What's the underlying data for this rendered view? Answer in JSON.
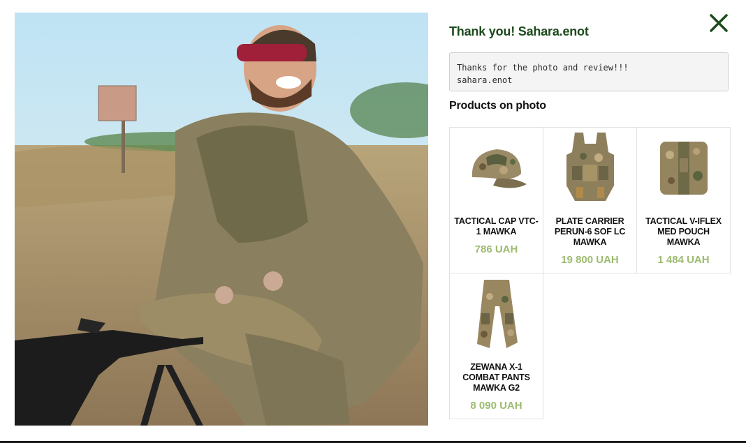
{
  "modal": {
    "title": "Thank you! Sahara.enot",
    "comment": "Thanks for the photo and review!!!\nsahara.enot",
    "products_heading": "Products on photo"
  },
  "colors": {
    "title": "#1d4a1d",
    "price": "#9dbb70",
    "close": "#1d4a1d"
  },
  "products": [
    {
      "name": "TACTICAL CAP VTC-1 MAWKA",
      "price": "786 UAH",
      "icon": "tactical-cap"
    },
    {
      "name": "PLATE CARRIER PERUN-6 SOF LC MAWKA",
      "price": "19 800 UAH",
      "icon": "plate-carrier"
    },
    {
      "name": "TACTICAL V-IFLEX MED POUCH MAWKA",
      "price": "1 484 UAH",
      "icon": "med-pouch"
    },
    {
      "name": "ZEWANA X-1 COMBAT PANTS MAWKA G2",
      "price": "8 090 UAH",
      "icon": "combat-pants"
    }
  ]
}
